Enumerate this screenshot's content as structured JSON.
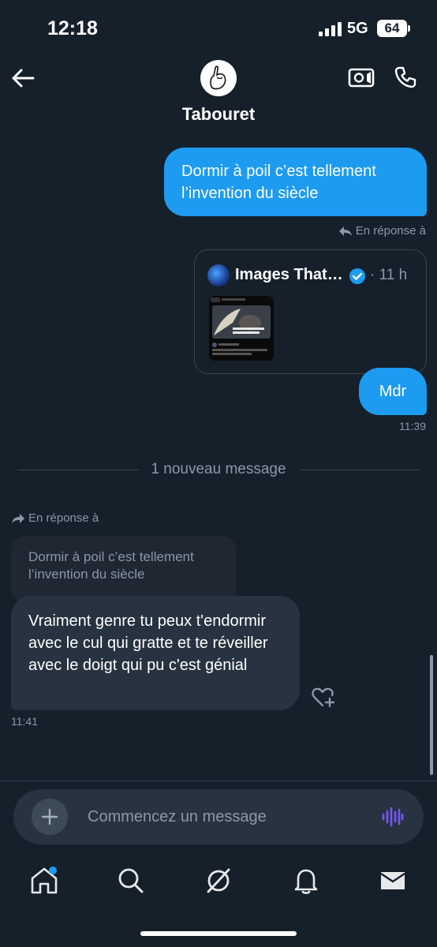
{
  "status_bar": {
    "time": "12:18",
    "network": "5G",
    "battery": "64"
  },
  "header": {
    "contact_name": "Tabouret"
  },
  "messages": {
    "sent_1": {
      "text": "Dormir à poil c’est tellement l’invention du siècle"
    },
    "reply_label_sent": "En réponse à",
    "tweet_card": {
      "author": "Images That…",
      "time": "11 h"
    },
    "sent_2": {
      "text": "Mdr",
      "timestamp": "11:39"
    },
    "divider": "1 nouveau message",
    "reply_label_received": "En réponse à",
    "quoted": "Dormir à poil c’est tellement l’invention du siècle",
    "received_1": {
      "text": "Vraiment genre tu peux t'endormir avec le cul qui gratte et te réveiller avec le doigt qui pu c'est génial",
      "timestamp": "11:41"
    }
  },
  "composer": {
    "placeholder": "Commencez un message"
  },
  "colors": {
    "accent": "#1d9bf0",
    "background": "#15202b",
    "received_bubble": "#273340",
    "voice": "#7856ff"
  },
  "tabs": [
    "home-icon",
    "search-icon",
    "grok-icon",
    "notifications-icon",
    "messages-icon"
  ]
}
